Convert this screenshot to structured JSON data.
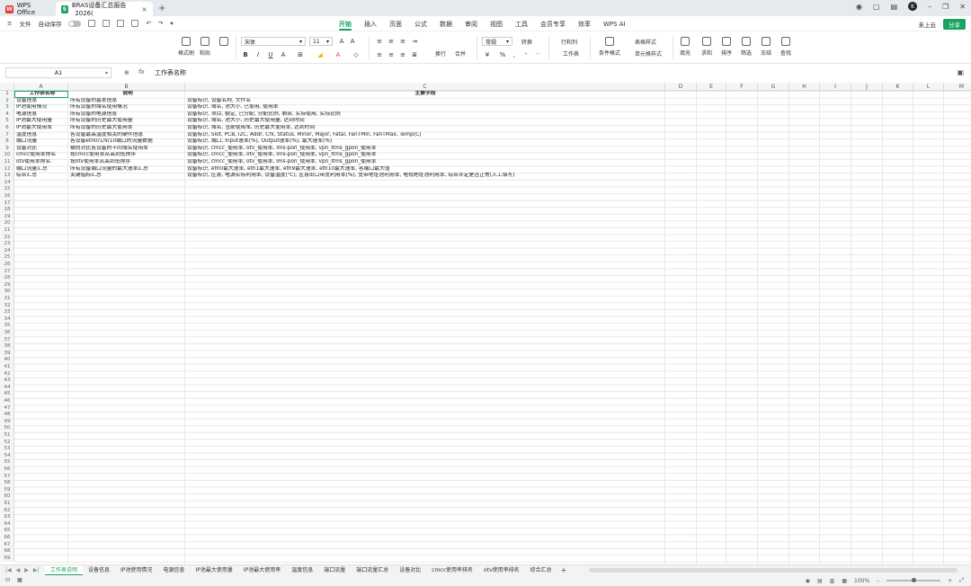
{
  "titlebar": {
    "app_tab": "WPS Office",
    "doc_tab": "BRAS设备汇总报告_2026(",
    "avatar_letter": "K"
  },
  "menubar": {
    "file": "文件",
    "autosave": "自动保存",
    "tabs": [
      "开始",
      "插入",
      "页面",
      "公式",
      "数据",
      "审阅",
      "视图",
      "工具",
      "会员专享",
      "效率",
      "WPS AI"
    ],
    "active_tab": "开始",
    "cloud": "未上云",
    "share": "分享"
  },
  "ribbon": {
    "format_painter": "格式刷",
    "paste": "粘贴",
    "font_name": "宋体",
    "font_size": "11",
    "wrap": "换行",
    "merge": "合并",
    "number_format": "常规",
    "convert": "转换",
    "rows_cols": "行和列",
    "worksheet": "工作表",
    "cond_format": "条件格式",
    "table_style": "表格样式",
    "cell_style": "单元格样式",
    "fill": "填充",
    "sum": "求和",
    "sort": "排序",
    "filter": "筛选",
    "freeze": "冻结",
    "find": "查找"
  },
  "formulabar": {
    "cell_ref": "A1",
    "formula": "工作表名称"
  },
  "columns": [
    "A",
    "B",
    "C",
    "D",
    "E",
    "F",
    "G",
    "H",
    "I",
    "J",
    "K",
    "L",
    "M"
  ],
  "rows": [
    [
      "工作表名称",
      "说明",
      "主要字段"
    ],
    [
      "设备信息",
      "所有设备的基本信息",
      "设备标识, 设备名称, 文件名"
    ],
    [
      "IP池使用情况",
      "所有设备的域名使用情况",
      "设备标识, 域名, 池大小, 已使用, 使用率"
    ],
    [
      "电源信息",
      "所有设备的电源信息",
      "设备标识, 项目, 额定, 已分配, 分配比例, 剩余, 实际使用, 实际比例"
    ],
    [
      "IP池最大使用量",
      "所有设备的历史最大使用量",
      "设备标识, 域名, 池大小, 历史最大使用量, 达到时间"
    ],
    [
      "IP池最大使用率",
      "所有设备的历史最大使用率",
      "设备标识, 域名, 当前使用率, 历史最大使用率, 达到时间"
    ],
    [
      "温度信息",
      "各设备最高温度相关的硬件信息",
      "设备标识, Slot, PCB, I2C, Addr, Chl, Status, Minor, Major, Fatal, FanTMin, FanTMax, Temp(C)"
    ],
    [
      "端口流量",
      "各设备eth0/1/9/10端口的流量数据",
      "设备标识, 端口, Input速率(%), Output速率(%), 最大速率(%)"
    ],
    [
      "设备对比",
      "横向对比各设备的不同域名使用率",
      "设备标识, cmcc_使用率, otv_使用率, ims-pon_使用率, vpn_ltms_gpon_使用率"
    ],
    [
      "cmcc使用率排名",
      "按cmcc使用率从高到低排序",
      "设备标识, cmcc_使用率, otv_使用率, ims-pon_使用率, vpn_ltms_gpon_使用率"
    ],
    [
      "otv使用率排名",
      "按otv使用率从高到低排序",
      "设备标识, cmcc_使用率, otv_使用率, ims-pon_使用率, vpn_ltms_gpon_使用率"
    ],
    [
      "端口流量汇总",
      "所有设备端口流量的最大速率汇总",
      "设备标识, eth0最大速率, eth1最大速率, eth9最大速率, eth10最大速率, 各端口最大值"
    ],
    [
      "综合汇总",
      "关键指标汇总",
      "设备标识, 区县, 电源实际利用率, 设备温度(℃), 区县出口带宽利用率(%), 宽带地址池利用率, 电视地址池利用率, 综合评定是否正常(人工填写)"
    ]
  ],
  "sheets": [
    "工作表说明",
    "设备信息",
    "IP池使用情况",
    "电源信息",
    "IP池最大使用量",
    "IP池最大使用率",
    "温度信息",
    "端口流量",
    "端口流量汇总",
    "设备对比",
    "cmcc使用率排名",
    "otv使用率排名",
    "综合汇总"
  ],
  "active_sheet": "工作表说明",
  "statusbar": {
    "zoom": "100%"
  },
  "accent_color": "#1aa260"
}
